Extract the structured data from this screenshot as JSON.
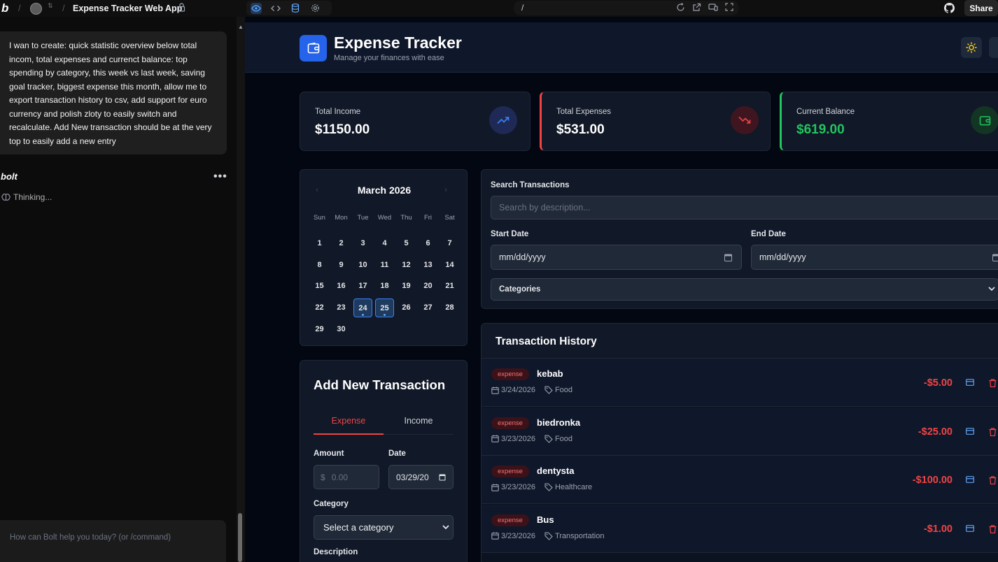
{
  "topbar": {
    "logo": "b",
    "project_title": "Expense Tracker Web App",
    "url": "/",
    "share_label": "Share"
  },
  "chat": {
    "user_message": "I wan to create: quick statistic overview below total incom, total expenses and currenct balance: top spending by category, this week vs last week, saving goal tracker, biggest expense this month, allow me to export transaction history to csv, add support for euro currency and polish zloty to easily switch and recalculate. Add New transaction should be at the very top to easily add a new entry",
    "assistant_name": "bolt",
    "status": "Thinking...",
    "input_placeholder": "How can Bolt help you today? (or /command)"
  },
  "app": {
    "title": "Expense Tracker",
    "subtitle": "Manage your finances with ease",
    "colors": {
      "accent": "#2563eb",
      "income": "#22c55e",
      "expense": "#ef4444"
    }
  },
  "stats": [
    {
      "label": "Total Income",
      "value": "$1150.00",
      "icon": "trending-up-icon",
      "color": "#3b82f6"
    },
    {
      "label": "Total Expenses",
      "value": "$531.00",
      "icon": "trending-down-icon",
      "color": "#ef4444"
    },
    {
      "label": "Current Balance",
      "value": "$619.00",
      "icon": "wallet-icon",
      "color": "#22c55e"
    }
  ],
  "calendar": {
    "month_label": "March 2026",
    "weekdays": [
      "Sun",
      "Mon",
      "Tue",
      "Wed",
      "Thu",
      "Fri",
      "Sat"
    ],
    "days": [
      "1",
      "2",
      "3",
      "4",
      "5",
      "6",
      "7",
      "8",
      "9",
      "10",
      "11",
      "12",
      "13",
      "14",
      "15",
      "16",
      "17",
      "18",
      "19",
      "20",
      "21",
      "22",
      "23",
      "24",
      "25",
      "26",
      "27",
      "28",
      "29",
      "30"
    ],
    "highlighted_days": [
      "24",
      "25"
    ]
  },
  "add_form": {
    "title": "Add New Transaction",
    "tab_expense": "Expense",
    "tab_income": "Income",
    "amount_label": "Amount",
    "currency_symbol": "$",
    "amount_placeholder": "0.00",
    "date_label": "Date",
    "date_value": "03/29/20",
    "category_label": "Category",
    "category_value": "Select a category",
    "description_label": "Description"
  },
  "filters": {
    "search_label": "Search Transactions",
    "search_placeholder": "Search by description...",
    "start_label": "Start Date",
    "start_placeholder": "mm/dd/yyyy",
    "end_label": "End Date",
    "end_placeholder": "mm/dd/yyyy",
    "categories_label": "Categories"
  },
  "history": {
    "title": "Transaction History",
    "rows": [
      {
        "type": "expense",
        "description": "kebab",
        "date": "3/24/2026",
        "category": "Food",
        "amount": "-$5.00"
      },
      {
        "type": "expense",
        "description": "biedronka",
        "date": "3/23/2026",
        "category": "Food",
        "amount": "-$25.00"
      },
      {
        "type": "expense",
        "description": "dentysta",
        "date": "3/23/2026",
        "category": "Healthcare",
        "amount": "-$100.00"
      },
      {
        "type": "expense",
        "description": "Bus",
        "date": "3/23/2026",
        "category": "Transportation",
        "amount": "-$1.00"
      }
    ]
  }
}
